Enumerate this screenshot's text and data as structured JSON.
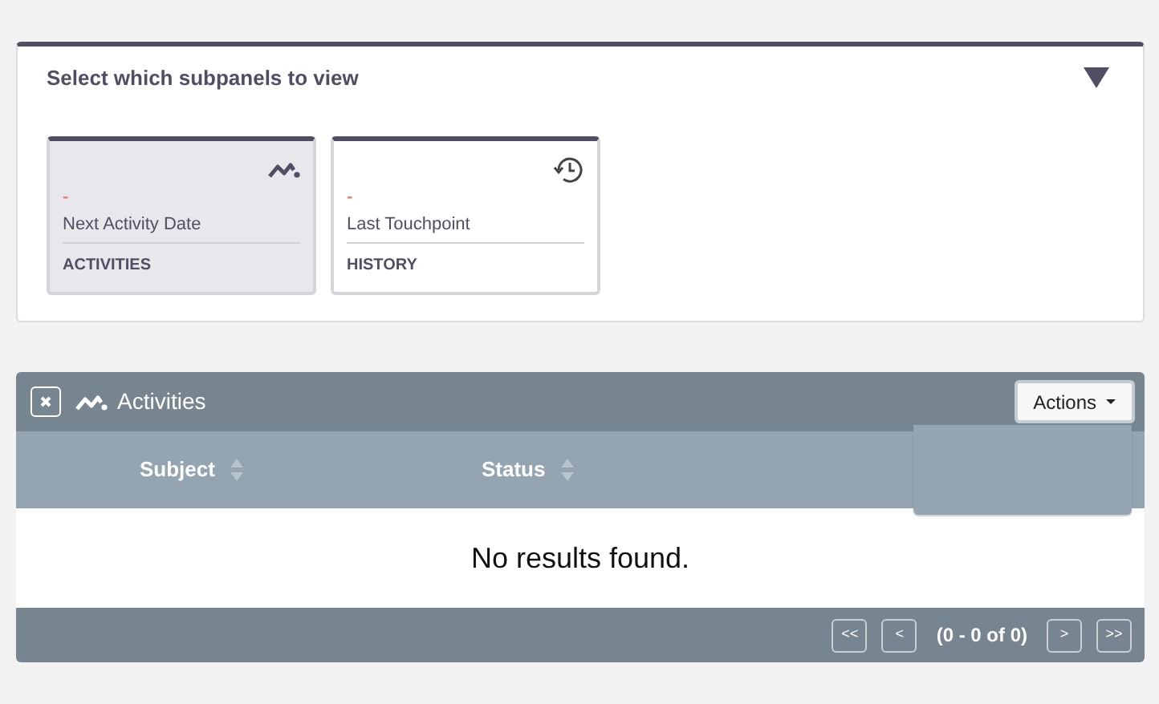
{
  "subpanel_selector": {
    "title": "Select which subpanels to view",
    "expanded": true,
    "cards": [
      {
        "kind": "activities",
        "value": "-",
        "label": "Next Activity Date",
        "category": "ACTIVITIES",
        "selected": true
      },
      {
        "kind": "history",
        "value": "-",
        "label": "Last Touchpoint",
        "category": "HISTORY",
        "selected": false
      }
    ]
  },
  "subpanel": {
    "title": "Activities",
    "actions_button": "Actions",
    "actions_menu_open": true,
    "columns": [
      {
        "label": "Subject"
      },
      {
        "label": "Status"
      }
    ],
    "empty_message": "No results found.",
    "pagination": {
      "first": "<<",
      "previous": "<",
      "range": "(0 - 0 of 0)",
      "next": ">",
      "last": ">>"
    }
  }
}
